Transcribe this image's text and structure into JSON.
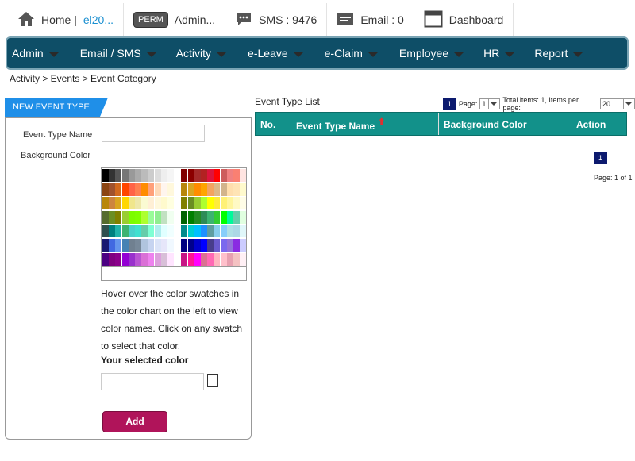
{
  "topbar": {
    "home_label": "Home |",
    "user_text": "el20...",
    "perm_badge": "PERM",
    "admin_label": "Admin...",
    "sms_label": "SMS : 9476",
    "email_label": "Email : 0",
    "dashboard_label": "Dashboard"
  },
  "nav": {
    "items": [
      "Admin",
      "Email / SMS",
      "Activity",
      "e-Leave",
      "e-Claim",
      "Employee",
      "HR",
      "Report"
    ]
  },
  "breadcrumb": "Activity > Events > Event Category",
  "form": {
    "tab_title": "NEW EVENT TYPE",
    "event_type_label": "Event Type Name",
    "event_type_value": "",
    "background_color_label": "Background Color",
    "hint": "Hover over the color swatches in the color chart on the left to view color names. Click on any swatch to select that color.",
    "selected_color_label": "Your selected color",
    "selected_color_value": "",
    "add_label": "Add"
  },
  "palette": {
    "rows": [
      [
        "#000000",
        "#333333",
        "#555555",
        "#777777",
        "#999999",
        "#aaaaaa",
        "#bbbbbb",
        "#cccccc",
        "#dddddd",
        "#eeeeee",
        "#f5f5f5",
        "#ffffff",
        "#800000",
        "#8b0000",
        "#a52a2a",
        "#b22222",
        "#dc143c",
        "#ff0000",
        "#cd5c5c",
        "#f08080",
        "#fa8072",
        "#ffe4e1"
      ],
      [
        "#8b4513",
        "#a0522d",
        "#d2691e",
        "#ff4500",
        "#ff6347",
        "#ff7f50",
        "#ff8c00",
        "#ffa07a",
        "#ffdab9",
        "#fff5ee",
        "#fff8dc",
        "#ffffff",
        "#b8860b",
        "#daa520",
        "#ff8c00",
        "#ffa500",
        "#f4a460",
        "#deb887",
        "#d2b48c",
        "#ffdead",
        "#ffe4b5",
        "#fffacd"
      ],
      [
        "#b8860b",
        "#cd853f",
        "#daa520",
        "#ffd700",
        "#f0e68c",
        "#eee8aa",
        "#fafad2",
        "#ffefd5",
        "#fff8dc",
        "#fffacd",
        "#ffffe0",
        "#ffffff",
        "#808000",
        "#6b8e23",
        "#9acd32",
        "#adff2f",
        "#ffff00",
        "#ffeb3b",
        "#fff176",
        "#fff59d",
        "#fff9c4",
        "#fffde7"
      ],
      [
        "#556b2f",
        "#6b8e23",
        "#808000",
        "#9acd32",
        "#7cfc00",
        "#7fff00",
        "#adff2f",
        "#98fb98",
        "#90ee90",
        "#c1e1c1",
        "#f0fff0",
        "#ffffff",
        "#006400",
        "#008000",
        "#228b22",
        "#2e8b57",
        "#3cb371",
        "#32cd32",
        "#00ff00",
        "#00fa9a",
        "#66cdaa",
        "#e0ffe0"
      ],
      [
        "#2f4f4f",
        "#008080",
        "#20b2aa",
        "#3cb371",
        "#48d1cc",
        "#40e0d0",
        "#66cdaa",
        "#7fffd4",
        "#afeeee",
        "#e0ffff",
        "#f0ffff",
        "#ffffff",
        "#008b8b",
        "#00ced1",
        "#00bfff",
        "#1e90ff",
        "#5f9ea0",
        "#87ceeb",
        "#87cefa",
        "#b0e0e6",
        "#add8e6",
        "#e0f7fa"
      ],
      [
        "#191970",
        "#4169e1",
        "#6495ed",
        "#4682b4",
        "#708090",
        "#778899",
        "#b0c4de",
        "#c6d4f0",
        "#dbe4f8",
        "#e6e6fa",
        "#f0f8ff",
        "#ffffff",
        "#000080",
        "#00008b",
        "#0000cd",
        "#0000ff",
        "#483d8b",
        "#6a5acd",
        "#7b68ee",
        "#9370db",
        "#8a2be2",
        "#ccccff"
      ],
      [
        "#4b0082",
        "#800080",
        "#8b008b",
        "#9400d3",
        "#9932cc",
        "#ba55d3",
        "#da70d6",
        "#ee82ee",
        "#dda0dd",
        "#d8bfd8",
        "#ffe4ff",
        "#ffffff",
        "#c71585",
        "#ff1493",
        "#ff00ff",
        "#db7093",
        "#ff69b4",
        "#ffb6c1",
        "#ffc0cb",
        "#e8a0b0",
        "#f4c2c2",
        "#fff0f5"
      ]
    ]
  },
  "list": {
    "title": "Event Type List",
    "current_page": "1",
    "page_label": "Page:",
    "page_select": "1",
    "total_items": "Total items: 1, Items per page:",
    "per_page": "20",
    "columns": [
      "No.",
      "Event Type Name",
      "Background Color",
      "Action"
    ],
    "bottom_page": "1",
    "page_of": "Page: 1 of 1"
  },
  "colors": {
    "nav_bg": "#0e4e67",
    "tab_blue": "#1f8fe8",
    "grid_header": "#12918a",
    "add_button": "#b0145a",
    "pager": "#0c1a6e"
  }
}
